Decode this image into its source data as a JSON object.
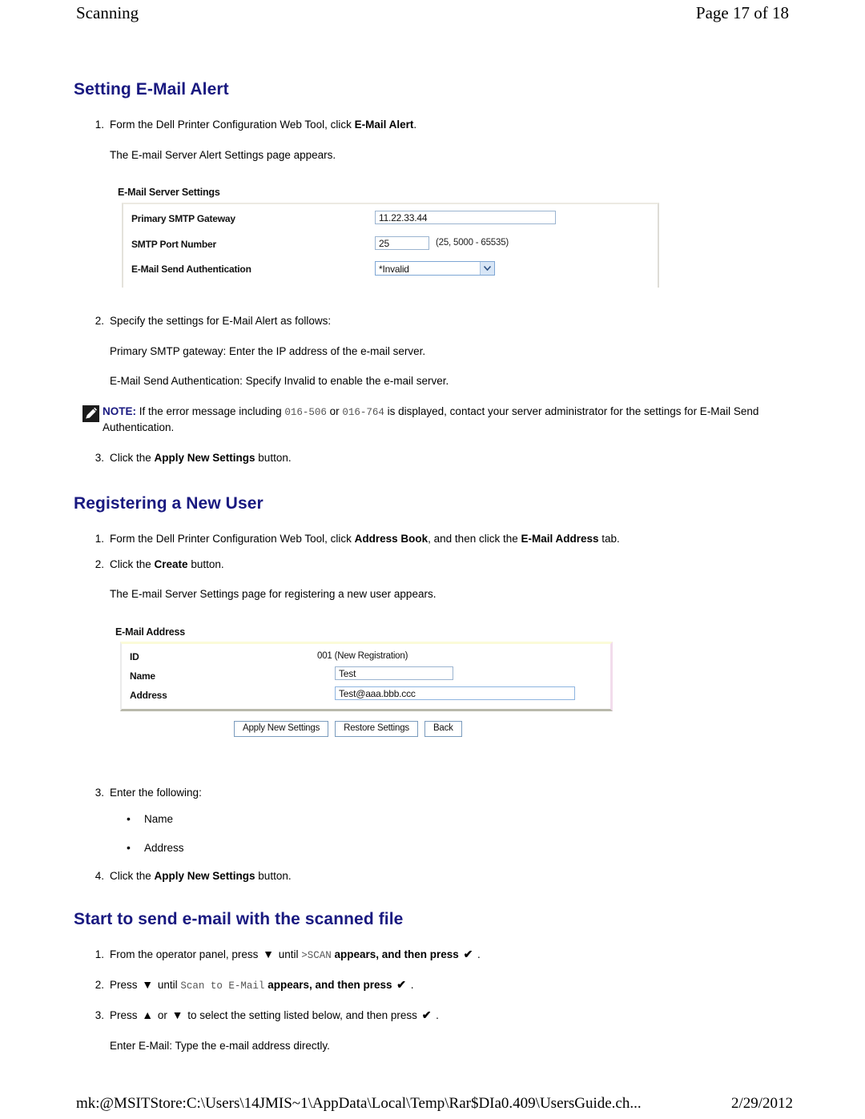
{
  "header": {
    "left_title": "Scanning",
    "page_label": "Page 17 of 18"
  },
  "footer": {
    "path": "mk:@MSITStore:C:\\Users\\14JMIS~1\\AppData\\Local\\Temp\\Rar$DIa0.409\\UsersGuide.ch...",
    "date": "2/29/2012"
  },
  "colors": {
    "heading": "#191980",
    "note_label": "#191980",
    "input_border": "#9bb4d0",
    "select_arrow_bg": "#d8e6f6"
  },
  "sections": {
    "setting_email_alert": {
      "title": "Setting E-Mail Alert",
      "step1_num": "1.",
      "step1_a": "Form the Dell Printer Configuration Web Tool, click ",
      "step1_b": "E-Mail Alert",
      "step1_c": ".",
      "step1_result": "The E-mail Server Alert Settings page appears.",
      "step2_num": "2.",
      "step2_text": "Specify the settings for E-Mail Alert as follows:",
      "step2_line1": "Primary SMTP gateway: Enter the IP address of the e-mail server.",
      "step2_line2": "E-Mail Send Authentication: Specify Invalid to enable the e-mail server.",
      "note_label": "NOTE:",
      "note_a": " If the error message including ",
      "note_code1": "016-506",
      "note_b": " or ",
      "note_code2": "016-764",
      "note_c": " is displayed, contact your server administrator for the settings for E-Mail Send Authentication.",
      "step3_num": "3.",
      "step3_a": "Click the ",
      "step3_b": "Apply New Settings",
      "step3_c": " button."
    },
    "registering_new_user": {
      "title": "Registering a New User",
      "step1_num": "1.",
      "step1_a": "Form the Dell Printer Configuration Web Tool, click ",
      "step1_b": "Address Book",
      "step1_c": ", and then click the ",
      "step1_d": "E-Mail Address",
      "step1_e": " tab.",
      "step2_num": "2.",
      "step2_a": "Click the ",
      "step2_b": "Create",
      "step2_c": " button.",
      "step2_result": "The E-mail Server Settings page for registering a new user appears.",
      "step3_num": "3.",
      "step3_text": "Enter the following:",
      "bullet1": "Name",
      "bullet2": "Address",
      "bullet_glyph": "•",
      "step4_num": "4.",
      "step4_a": "Click the ",
      "step4_b": "Apply New Settings",
      "step4_c": " button."
    },
    "start_send_email": {
      "title": "Start to send e-mail with the scanned file",
      "step1_num": "1.",
      "step1_a": "From the operator panel, press ",
      "step1_down": "▼",
      "step1_b": " until ",
      "step1_code": ">SCAN",
      "step1_c": " appears, and then press ",
      "step1_check": "✔",
      "step1_d": " .",
      "step2_num": "2.",
      "step2_a": "Press ",
      "step2_down": "▼",
      "step2_b": " until ",
      "step2_code": "Scan to E-Mail",
      "step2_c": " appears, and then press ",
      "step2_check": "✔",
      "step2_d": " .",
      "step3_num": "3.",
      "step3_a": "Press ",
      "step3_up": "▲",
      "step3_b": " or ",
      "step3_down": "▼",
      "step3_c": " to select the setting listed below, and then press ",
      "step3_check": "✔",
      "step3_d": " .",
      "step3_result": "Enter E-Mail: Type the e-mail address directly."
    }
  },
  "figure_email_server_settings": {
    "title": "E-Mail Server Settings",
    "rows": [
      {
        "label": "Primary SMTP Gateway",
        "value": "11.22.33.44"
      },
      {
        "label": "SMTP Port Number",
        "value": "25",
        "hint": "(25, 5000 - 65535)"
      },
      {
        "label": "E-Mail Send Authentication",
        "value": "*Invalid"
      }
    ]
  },
  "figure_email_address": {
    "title": "E-Mail Address",
    "rows": [
      {
        "label": "ID",
        "value": "001 (New Registration)"
      },
      {
        "label": "Name",
        "value": "Test"
      },
      {
        "label": "Address",
        "value": "Test@aaa.bbb.ccc"
      }
    ],
    "buttons": [
      "Apply New Settings",
      "Restore Settings",
      "Back"
    ]
  }
}
